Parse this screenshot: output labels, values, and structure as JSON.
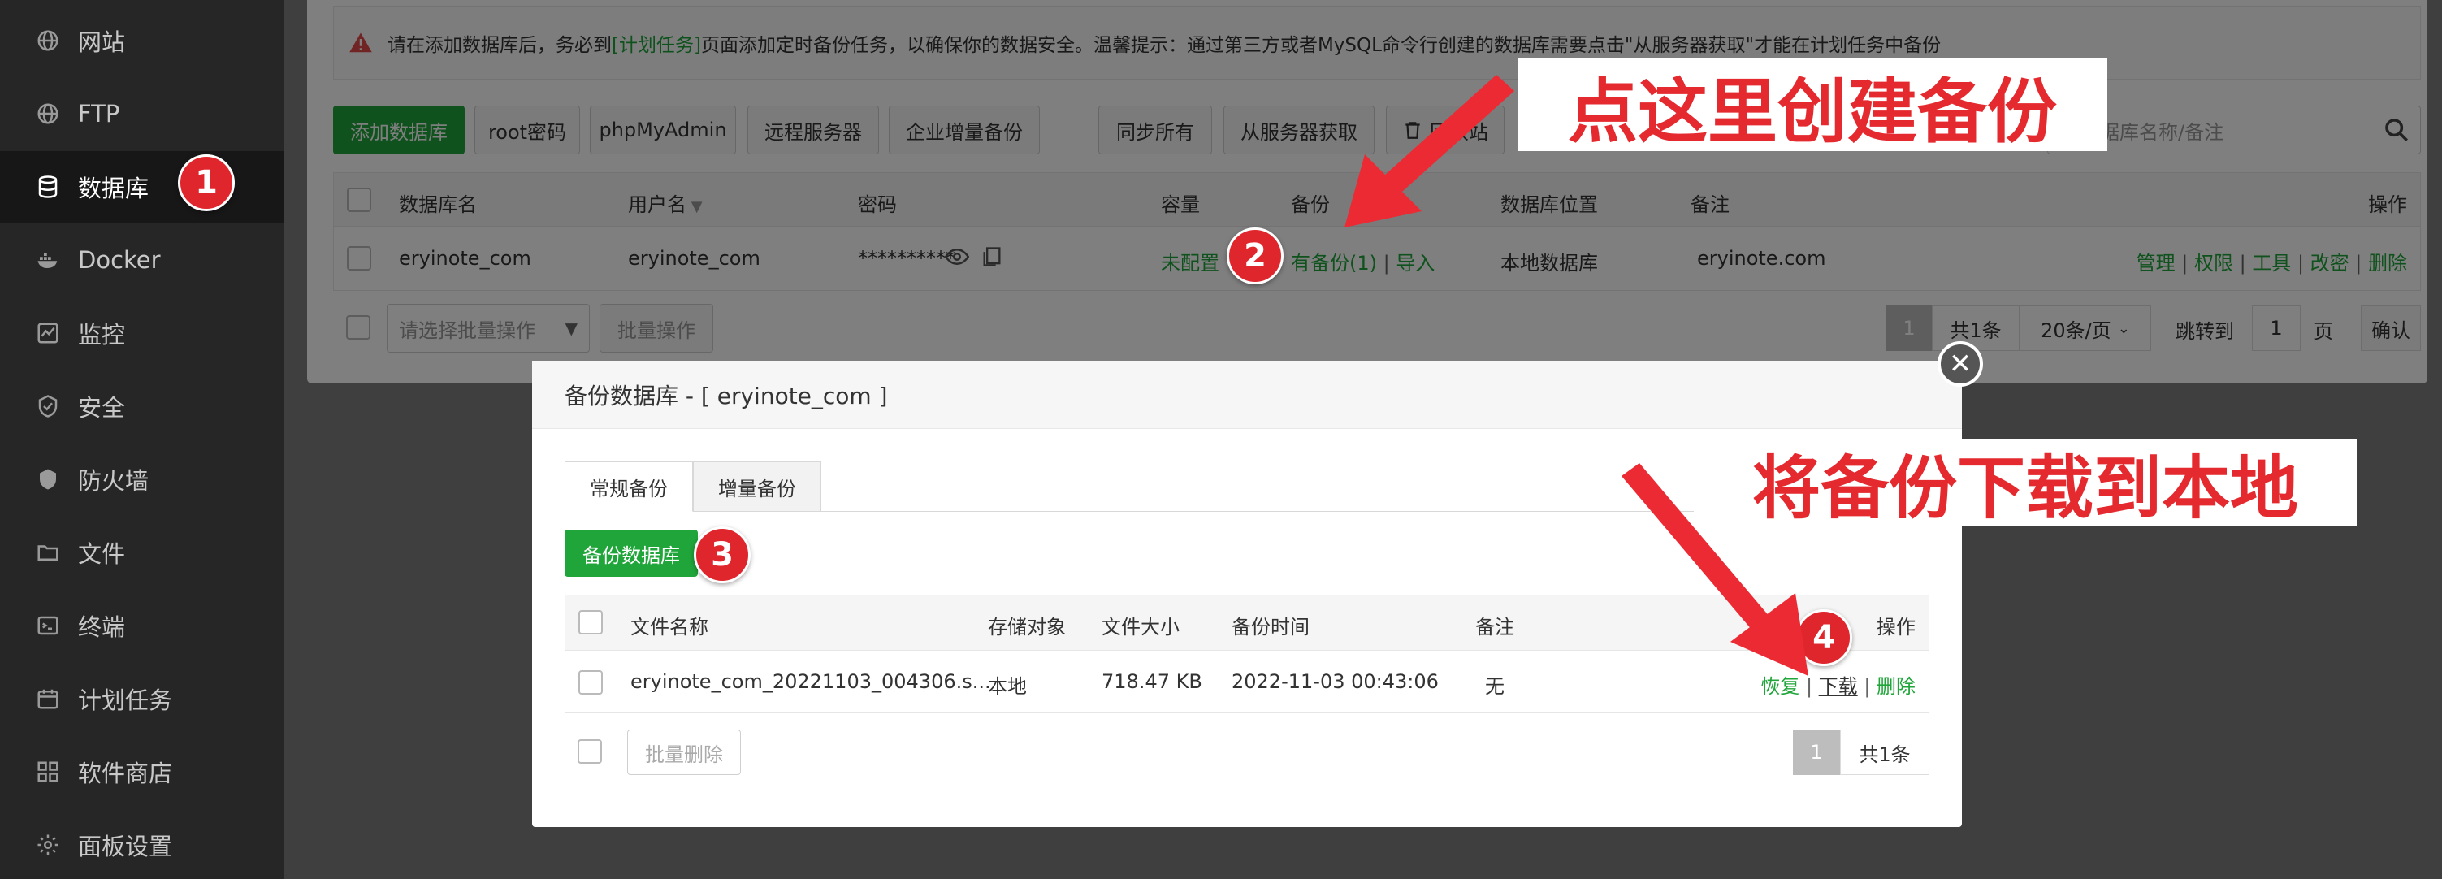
{
  "sidebar": {
    "items": [
      {
        "label": "网站",
        "icon": "globe-icon"
      },
      {
        "label": "FTP",
        "icon": "globe-icon"
      },
      {
        "label": "数据库",
        "icon": "database-icon"
      },
      {
        "label": "Docker",
        "icon": "docker-icon"
      },
      {
        "label": "监控",
        "icon": "monitor-icon"
      },
      {
        "label": "安全",
        "icon": "shield-icon"
      },
      {
        "label": "防火墙",
        "icon": "firewall-icon"
      },
      {
        "label": "文件",
        "icon": "folder-icon"
      },
      {
        "label": "终端",
        "icon": "terminal-icon"
      },
      {
        "label": "计划任务",
        "icon": "calendar-icon"
      },
      {
        "label": "软件商店",
        "icon": "grid-icon"
      },
      {
        "label": "面板设置",
        "icon": "gear-icon"
      }
    ],
    "active": "数据库"
  },
  "notice": {
    "pre": "请在添加数据库后，务必到",
    "link": "[计划任务]",
    "post": "页面添加定时备份任务，以确保你的数据安全。温馨提示：通过第三方或者MySQL命令行创建的数据库需要点击\"从服务器获取\"才能在计划任务中备份"
  },
  "toolbar": {
    "add_db": "添加数据库",
    "root_pwd": "root密码",
    "phpmyadmin": "phpMyAdmin",
    "remote": "远程服务器",
    "enterprise_backup": "企业增量备份",
    "sync_all": "同步所有",
    "fetch_server": "从服务器获取",
    "recycle": "回收站",
    "search_placeholder": "入数据库名称/备注"
  },
  "db_table": {
    "headers": {
      "name": "数据库名",
      "user": "用户名",
      "password": "密码",
      "capacity": "容量",
      "backup": "备份",
      "location": "数据库位置",
      "remark": "备注",
      "ops": "操作"
    },
    "row": {
      "name": "eryinote_com",
      "user": "eryinote_com",
      "password": "**********",
      "capacity": "未配置",
      "backup": "有备份(1)",
      "import": "导入",
      "location": "本地数据库",
      "remark": "eryinote.com",
      "ops": [
        "管理",
        "权限",
        "工具",
        "改密",
        "删除"
      ]
    }
  },
  "batch": {
    "select_placeholder": "请选择批量操作",
    "button": "批量操作"
  },
  "pager": {
    "current": "1",
    "total": "共1条",
    "per_page": "20条/页",
    "jump_label": "跳转到",
    "jump_value": "1",
    "page_unit": "页",
    "confirm": "确认"
  },
  "modal": {
    "title": "备份数据库 - [ eryinote_com ]",
    "tabs": [
      "常规备份",
      "增量备份"
    ],
    "backup_button": "备份数据库",
    "headers": {
      "filename": "文件名称",
      "storage": "存储对象",
      "size": "文件大小",
      "time": "备份时间",
      "remark": "备注",
      "ops": "操作"
    },
    "row": {
      "filename": "eryinote_com_20221103_004306.s...",
      "storage": "本地",
      "size": "718.47 KB",
      "time": "2022-11-03 00:43:06",
      "remark": "无",
      "restore": "恢复",
      "download": "下载",
      "delete": "删除"
    },
    "batch_delete": "批量删除",
    "pager_current": "1",
    "pager_total": "共1条"
  },
  "annotations": {
    "callout_1": "点这里创建备份",
    "callout_2": "将备份下载到本地",
    "steps": [
      "1",
      "2",
      "3",
      "4"
    ],
    "color": "#e42a2f"
  },
  "colors": {
    "accent": "#20a53a",
    "sidebar_bg": "#262626",
    "annotation": "#e42a2f"
  }
}
